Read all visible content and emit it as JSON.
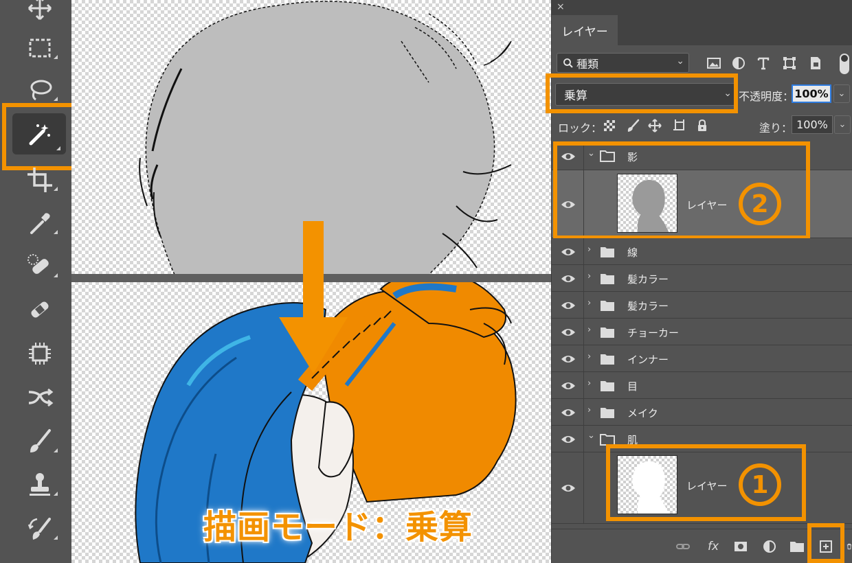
{
  "toolbar": {
    "tools": [
      {
        "name": "move-tool"
      },
      {
        "name": "rectangular-marquee-tool"
      },
      {
        "name": "lasso-tool"
      },
      {
        "name": "magic-wand-tool",
        "active": true
      },
      {
        "name": "crop-tool"
      },
      {
        "name": "eyedropper-tool"
      },
      {
        "name": "spot-healing-brush-tool"
      },
      {
        "name": "healing-brush-tool"
      },
      {
        "name": "chip-tool"
      },
      {
        "name": "content-aware-move-tool"
      },
      {
        "name": "brush-tool"
      },
      {
        "name": "clone-stamp-tool"
      },
      {
        "name": "history-brush-tool"
      }
    ]
  },
  "canvas": {
    "caption": "描画モード：乗算"
  },
  "panel": {
    "close_glyph": "×",
    "tab_label": "レイヤー",
    "filter": {
      "label": "種類"
    },
    "blend_mode": "乗算",
    "opacity_label": "不透明度：",
    "opacity_value": "100%",
    "lock_label": "ロック：",
    "fill_label": "塗り：",
    "fill_value": "100%",
    "layers": [
      {
        "name": "影",
        "type": "group",
        "expanded": true
      },
      {
        "name": "レイヤー",
        "type": "layer",
        "selected": true,
        "badge": "2"
      },
      {
        "name": "線",
        "type": "group",
        "expanded": false
      },
      {
        "name": "髪カラー",
        "type": "group",
        "expanded": false
      },
      {
        "name": "髪カラー",
        "type": "group",
        "expanded": false
      },
      {
        "name": "チョーカー",
        "type": "group",
        "expanded": false
      },
      {
        "name": "インナー",
        "type": "group",
        "expanded": false
      },
      {
        "name": "目",
        "type": "group",
        "expanded": false
      },
      {
        "name": "メイク",
        "type": "group",
        "expanded": false
      },
      {
        "name": "肌",
        "type": "group",
        "expanded": true
      },
      {
        "name": "レイヤー",
        "type": "layer",
        "selected": false,
        "badge": "1"
      }
    ],
    "footer": {
      "fx_label": "fx"
    }
  },
  "colors": {
    "highlight": "#f39200",
    "panel_bg": "#535353",
    "hair_blue": "#1f78c8",
    "hair_orange": "#f08a00",
    "selection_gray": "#bdbdbd"
  }
}
